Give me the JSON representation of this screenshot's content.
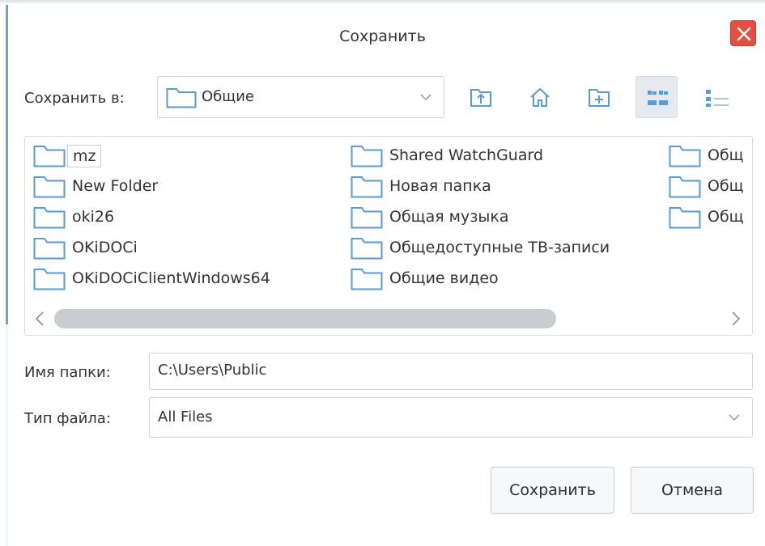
{
  "dialog": {
    "title": "Сохранить"
  },
  "location": {
    "label": "Сохранить в:",
    "value": "Общие"
  },
  "toolbar": {
    "icons": [
      "folder-up-icon",
      "home-icon",
      "new-folder-icon",
      "icon-view-icon",
      "detail-view-icon"
    ],
    "active": "icon-view-icon"
  },
  "files": {
    "columns": [
      [
        "mz",
        "New Folder",
        "oki26",
        "OKiDOCi",
        "OKiDOCiClientWindows64"
      ],
      [
        "Shared WatchGuard",
        "Новая папка",
        "Общая музыка",
        "Общедоступные ТВ-записи",
        "Общие видео"
      ],
      [
        "Общ",
        "Общ",
        "Общ"
      ]
    ],
    "selected": "mz"
  },
  "folder_name": {
    "label": "Имя папки:",
    "value": "C:\\Users\\Public"
  },
  "file_type": {
    "label": "Тип файла:",
    "value": "All Files"
  },
  "buttons": {
    "save": "Сохранить",
    "cancel": "Отмена"
  },
  "colors": {
    "accent": "#5b9bd5",
    "close": "#e24f43"
  }
}
